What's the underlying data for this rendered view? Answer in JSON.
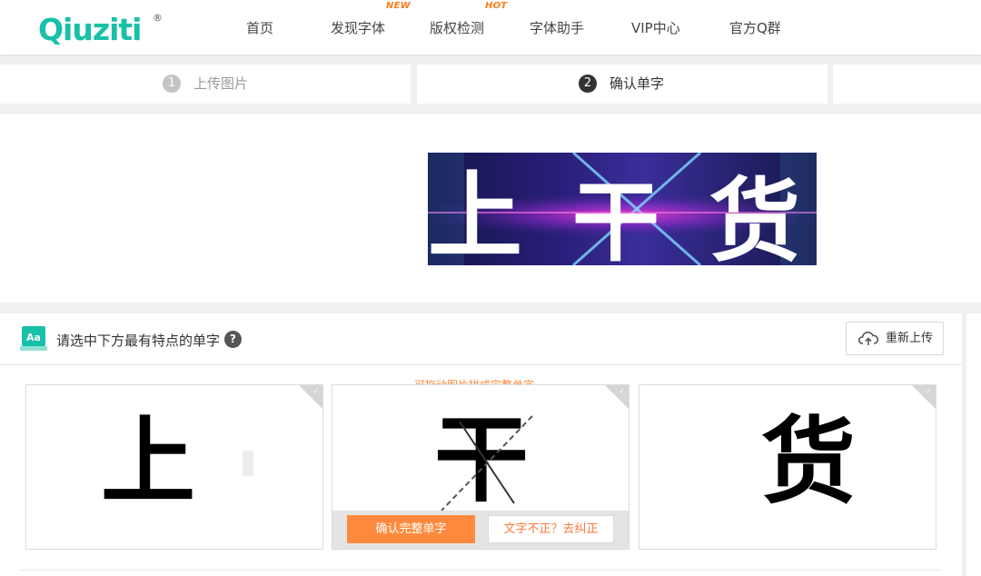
{
  "header": {
    "logo_text": "Qiuziti",
    "logo_mark": "®",
    "nav": [
      {
        "label": "首页",
        "badge": ""
      },
      {
        "label": "发现字体",
        "badge": "NEW"
      },
      {
        "label": "版权检测",
        "badge": "HOT"
      },
      {
        "label": "字体助手",
        "badge": ""
      },
      {
        "label": "VIP中心",
        "badge": ""
      },
      {
        "label": "官方Q群",
        "badge": ""
      }
    ]
  },
  "steps": [
    {
      "num": "1",
      "label": "上传图片",
      "state": "done"
    },
    {
      "num": "2",
      "label": "确认单字",
      "state": "active"
    }
  ],
  "preview": {
    "chars": [
      "上",
      "干",
      "货"
    ]
  },
  "panel": {
    "title": "请选中下方最有特点的单字",
    "help": "?",
    "reupload_label": "重新上传",
    "drag_hint": "可拖动图片拼成完整单字",
    "cards": [
      {
        "char": "上"
      },
      {
        "char": "干"
      },
      {
        "char": "货"
      }
    ],
    "confirm_label": "确认完整单字",
    "correct_label": "文字不正？去纠正"
  },
  "colors": {
    "accent": "#ff8a3d",
    "brand": "#19c0a8",
    "badge": "#ff7a1a"
  }
}
